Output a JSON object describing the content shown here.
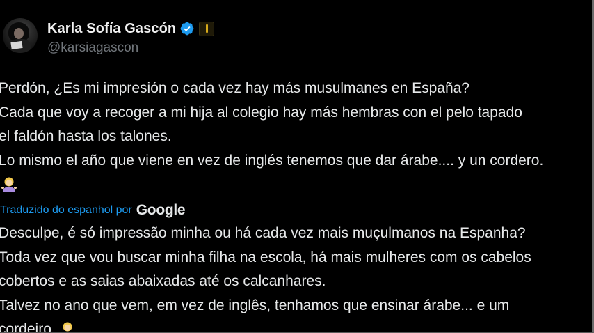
{
  "tweet": {
    "author": {
      "display_name": "Karla Sofía Gascón",
      "handle": "@karsiagascon",
      "verified": true,
      "affiliate_badge": "affiliate-badge-icon"
    },
    "original_text": [
      "Perdón, ¿Es mi impresión o cada vez hay más musulmanes en España?",
      "Cada que voy a recoger a mi hija al colegio hay más hembras con el pelo tapado",
      "el faldón hasta los talones.",
      "Lo mismo el año que viene en vez de inglés tenemos que dar árabe.... y un cordero."
    ],
    "original_emoji": "woman-shrugging-emoji",
    "translation": {
      "credit_label": "Traduzido do espanhol por",
      "provider": "Google"
    },
    "translated_text": [
      "Desculpe, é só impressão minha ou há cada vez mais muçulmanos na Espanha?",
      "Toda vez que vou buscar minha filha na escola, há mais mulheres com os cabelos",
      "cobertos e as saias abaixadas até os calcanhares.",
      "Talvez no ano que vem, em vez de inglês, tenhamos que ensinar árabe... e um",
      "cordeiro."
    ],
    "translated_emoji": "woman-shrugging-emoji"
  },
  "colors": {
    "background": "#000000",
    "text": "#e7e9ea",
    "muted": "#71767b",
    "link": "#1d9bf0",
    "verified": "#1d9bf0",
    "affiliate_gold": "#d6a91b"
  }
}
